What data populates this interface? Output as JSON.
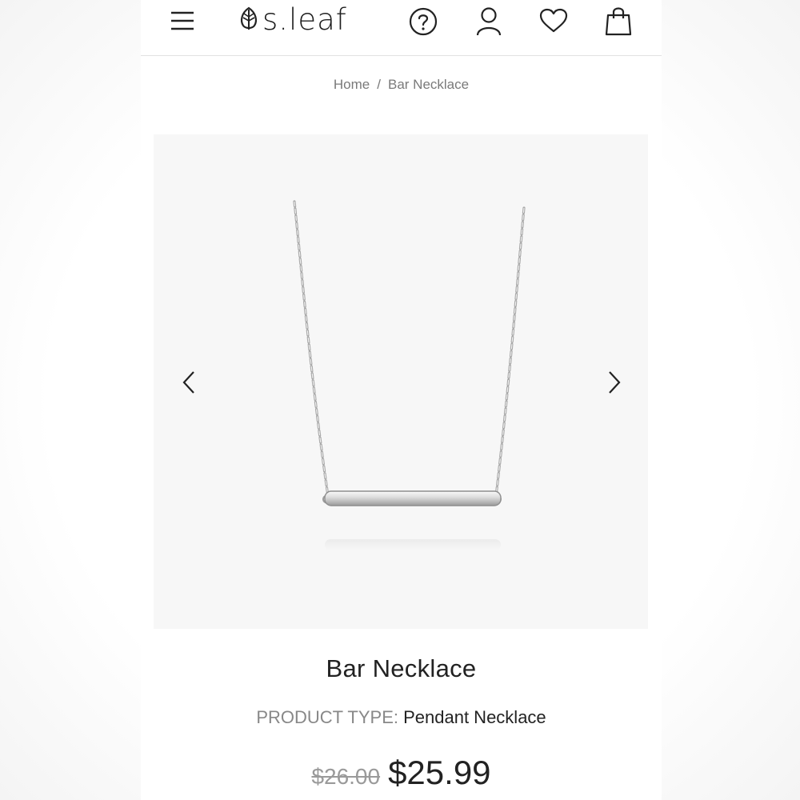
{
  "header": {
    "brand": "s.leaf",
    "icons": [
      "menu-icon",
      "help-icon",
      "account-icon",
      "wishlist-icon",
      "cart-icon"
    ]
  },
  "breadcrumb": {
    "home": "Home",
    "separator": "/",
    "current": "Bar Necklace"
  },
  "product": {
    "title": "Bar Necklace",
    "type_label": "PRODUCT TYPE:",
    "type_value": "Pendant Necklace",
    "price_old": "$26.00",
    "price_new": "$25.99"
  },
  "colors": {
    "text": "#222222",
    "muted": "#888888",
    "image_bg": "#f7f7f7"
  }
}
